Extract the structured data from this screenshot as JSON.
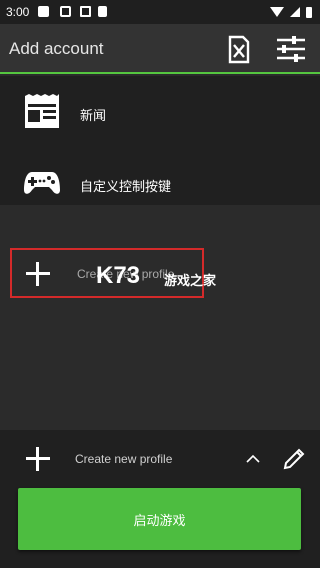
{
  "status_bar": {
    "time": "3:00"
  },
  "app_bar": {
    "title": "Add account",
    "icons": [
      "clear-sdcard-icon",
      "settings-sliders-icon"
    ]
  },
  "menu": {
    "items": [
      {
        "label": "新闻",
        "icon": "news-icon"
      },
      {
        "label": "自定义控制按键",
        "icon": "gamepad-icon"
      }
    ]
  },
  "profiles": {
    "create_label": "Create new profile"
  },
  "watermark": {
    "logo": "K73",
    "sub": "游戏之家"
  },
  "bottom": {
    "profile_label": "Create new profile",
    "launch_label": "启动游戏"
  },
  "colors": {
    "accent": "#55c640",
    "launch_button": "#4dbd40",
    "highlight": "#d42a2a"
  }
}
